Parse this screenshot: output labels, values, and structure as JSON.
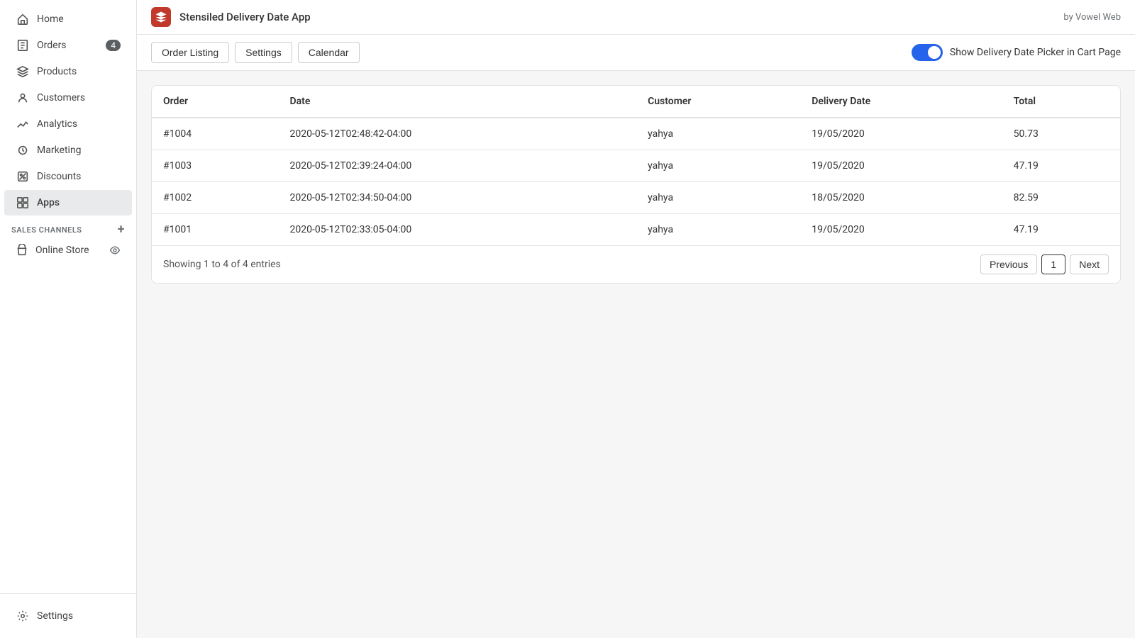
{
  "sidebar": {
    "items": [
      {
        "id": "home",
        "label": "Home",
        "icon": "home"
      },
      {
        "id": "orders",
        "label": "Orders",
        "icon": "orders",
        "badge": "4"
      },
      {
        "id": "products",
        "label": "Products",
        "icon": "products"
      },
      {
        "id": "customers",
        "label": "Customers",
        "icon": "customers"
      },
      {
        "id": "analytics",
        "label": "Analytics",
        "icon": "analytics"
      },
      {
        "id": "marketing",
        "label": "Marketing",
        "icon": "marketing"
      },
      {
        "id": "discounts",
        "label": "Discounts",
        "icon": "discounts"
      },
      {
        "id": "apps",
        "label": "Apps",
        "icon": "apps",
        "active": true
      }
    ],
    "sales_channels_label": "SALES CHANNELS",
    "online_store_label": "Online Store",
    "settings_label": "Settings"
  },
  "app_header": {
    "app_name": "Stensiled Delivery Date App",
    "by_label": "by Vowel Web"
  },
  "toolbar": {
    "buttons": [
      {
        "id": "order-listing",
        "label": "Order Listing"
      },
      {
        "id": "settings",
        "label": "Settings"
      },
      {
        "id": "calendar",
        "label": "Calendar"
      }
    ],
    "toggle_label": "Show Delivery Date Picker in Cart Page",
    "toggle_on": true
  },
  "table": {
    "columns": [
      {
        "id": "order",
        "label": "Order"
      },
      {
        "id": "date",
        "label": "Date"
      },
      {
        "id": "customer",
        "label": "Customer"
      },
      {
        "id": "delivery_date",
        "label": "Delivery Date"
      },
      {
        "id": "total",
        "label": "Total"
      }
    ],
    "rows": [
      {
        "order": "#1004",
        "date": "2020-05-12T02:48:42-04:00",
        "customer": "yahya",
        "delivery_date": "19/05/2020",
        "total": "50.73"
      },
      {
        "order": "#1003",
        "date": "2020-05-12T02:39:24-04:00",
        "customer": "yahya",
        "delivery_date": "19/05/2020",
        "total": "47.19"
      },
      {
        "order": "#1002",
        "date": "2020-05-12T02:34:50-04:00",
        "customer": "yahya",
        "delivery_date": "18/05/2020",
        "total": "82.59"
      },
      {
        "order": "#1001",
        "date": "2020-05-12T02:33:05-04:00",
        "customer": "yahya",
        "delivery_date": "19/05/2020",
        "total": "47.19"
      }
    ]
  },
  "pagination": {
    "info": "Showing 1 to 4 of 4 entries",
    "previous_label": "Previous",
    "next_label": "Next",
    "current_page": "1"
  }
}
